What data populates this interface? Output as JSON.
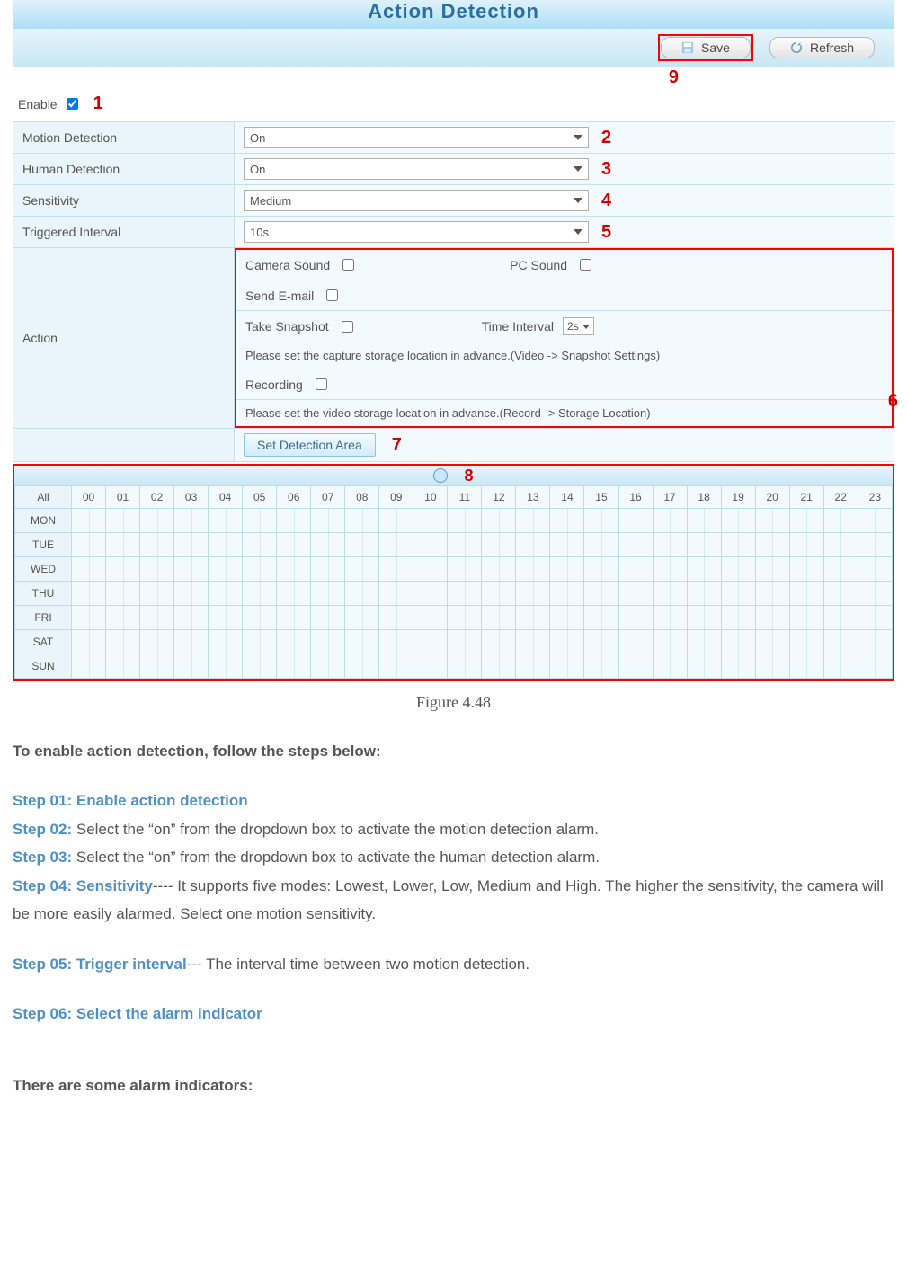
{
  "banner": {
    "title": "Action Detection"
  },
  "toolbar": {
    "save": "Save",
    "refresh": "Refresh",
    "callout": "9"
  },
  "enable": {
    "label": "Enable",
    "checked": true,
    "callout": "1"
  },
  "rows": {
    "motion": {
      "label": "Motion Detection",
      "value": "On",
      "callout": "2"
    },
    "human": {
      "label": "Human Detection",
      "value": "On",
      "callout": "3"
    },
    "sensitivity": {
      "label": "Sensitivity",
      "value": "Medium",
      "callout": "4"
    },
    "interval": {
      "label": "Triggered Interval",
      "value": "10s",
      "callout": "5"
    }
  },
  "action": {
    "label": "Action",
    "callout": "6",
    "camera_sound": "Camera Sound",
    "pc_sound": "PC Sound",
    "send_email": "Send E-mail",
    "snapshot": "Take Snapshot",
    "time_interval_label": "Time Interval",
    "time_interval_value": "2s",
    "snapshot_hint": "Please set the capture storage location in advance.(Video -> Snapshot Settings)",
    "recording": "Recording",
    "recording_hint": "Please set the video storage location in advance.(Record -> Storage Location)",
    "set_area": "Set Detection Area",
    "set_area_callout": "7"
  },
  "schedule": {
    "callout": "8",
    "all": "All",
    "hours": [
      "00",
      "01",
      "02",
      "03",
      "04",
      "05",
      "06",
      "07",
      "08",
      "09",
      "10",
      "11",
      "12",
      "13",
      "14",
      "15",
      "16",
      "17",
      "18",
      "19",
      "20",
      "21",
      "22",
      "23"
    ],
    "days": [
      "MON",
      "TUE",
      "WED",
      "THU",
      "FRI",
      "SAT",
      "SUN"
    ]
  },
  "caption": "Figure 4.48",
  "text": {
    "lead": "To enable action detection, follow the steps below:",
    "s1": "Step 01: Enable action detection",
    "s2p": "Step 02:",
    "s2": " Select the “on” from the dropdown box to activate the motion detection alarm.",
    "s3p": "Step 03:",
    "s3": " Select the “on” from the dropdown box to activate the human detection alarm.",
    "s4p": "Step 04: Sensitivity",
    "s4": "---- It supports five modes: Lowest, Lower, Low, Medium and High. The higher the sensitivity, the camera will be more easily alarmed. Select one motion sensitivity.",
    "s5p": "Step 05: Trigger interval",
    "s5": "--- The interval time between two motion detection.",
    "s6": "Step 06: Select the alarm indicator",
    "foot": "There are some alarm indicators:"
  }
}
